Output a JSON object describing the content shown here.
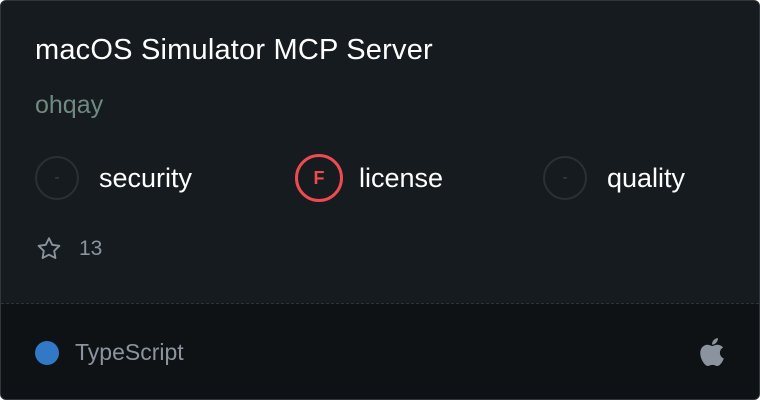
{
  "card": {
    "title": "macOS Simulator MCP Server",
    "owner": "ohqay"
  },
  "badges": [
    {
      "label": "security",
      "grade": "-",
      "status": "none"
    },
    {
      "label": "license",
      "grade": "F",
      "status": "fail"
    },
    {
      "label": "quality",
      "grade": "-",
      "status": "none"
    }
  ],
  "stars": {
    "icon": "star-icon",
    "count": "13"
  },
  "footer": {
    "language": "TypeScript",
    "language_color": "#3178c6",
    "platform_icon": "apple-icon"
  },
  "colors": {
    "background": "#151b1e",
    "fail": "#ef4a4f",
    "muted": "#8b949e"
  }
}
